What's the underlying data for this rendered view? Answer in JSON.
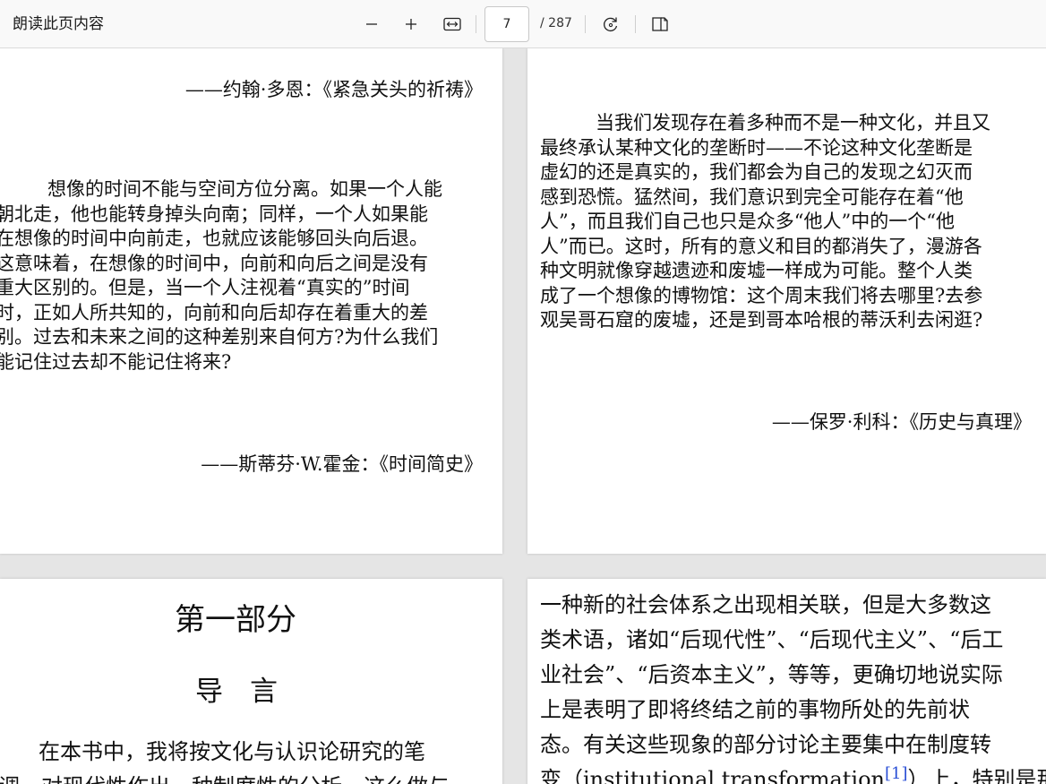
{
  "toolbar": {
    "read_aloud_label": "朗读此页内容",
    "current_page": "7",
    "total_pages": "/ 287"
  },
  "icons": {
    "zoom_out": "minus-icon",
    "zoom_in": "plus-icon",
    "fit": "fit-width-icon",
    "rotate": "rotate-icon",
    "page_view": "page-view-icon"
  },
  "pages": {
    "p1": {
      "epigraph1_attribution": "——约翰·多恩：《紧急关头的祈祷》",
      "paragraph_lines": [
        "想像的时间不能与空间方位分离。如果一个人能",
        "朝北走，他也能转身掉头向南；同样，一个人如果能",
        "在想像的时间中向前走，也就应该能够回头向后退。",
        "这意味着，在想像的时间中，向前和向后之间是没有",
        "重大区别的。但是，当一个人注视着“真实的”时间",
        "时，正如人所共知的，向前和向后却存在着重大的差",
        "别。过去和未来之间的这种差别来自何方?为什么我们",
        "能记住过去却不能记住将来?"
      ],
      "epigraph2_attribution": "——斯蒂芬·W.霍金：《时间简史》"
    },
    "p2": {
      "paragraph_lines": [
        "当我们发现存在着多种而不是一种文化，并且又",
        "最终承认某种文化的垄断时——不论这种文化垄断是",
        "虚幻的还是真实的，我们都会为自己的发现之幻灭而",
        "感到恐慌。猛然间，我们意识到完全可能存在着“他",
        "人”，而且我们自己也只是众多“他人”中的一个“他",
        "人”而已。这时，所有的意义和目的都消失了，漫游各",
        "种文明就像穿越遗迹和废墟一样成为可能。整个人类",
        "成了一个想像的博物馆：这个周末我们将去哪里?去参",
        "观吴哥石窟的废墟，还是到哥本哈根的蒂沃利去闲逛?"
      ],
      "attribution": "——保罗·利科：《历史与真理》"
    },
    "p3": {
      "part_title": "第一部分",
      "intro_title": "导言",
      "paragraph_lines": [
        "在本书中，我将按文化与认识论研究的笔",
        "调，对现代性作出一种制度性的分析。这么做与"
      ]
    },
    "p4": {
      "lines": [
        "一种新的社会体系之出现相关联，但是大多数这",
        "类术语，诸如“后现代性”、“后现代主义”、“后工",
        "业社会”、“后资本主义”，等等，更确切地说实际",
        "上是表明了即将终结之前的事物所处的先前状",
        "态。有关这些现象的部分讨论主要集中在制度转"
      ],
      "last_line_before": "变（institutional transformation",
      "footnote": "[1]",
      "last_line_after": "）上，特别是那"
    }
  }
}
